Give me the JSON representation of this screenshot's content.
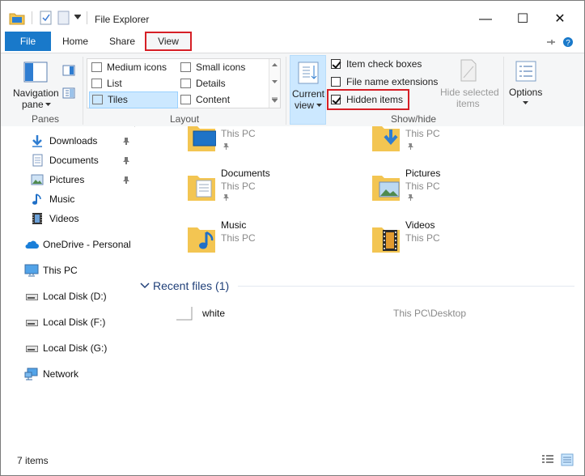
{
  "window": {
    "title": "File Explorer",
    "minimize_glyph": "—",
    "maximize_glyph": "☐",
    "close_glyph": "✕"
  },
  "tabs": [
    {
      "label": "File"
    },
    {
      "label": "Home"
    },
    {
      "label": "Share"
    },
    {
      "label": "View"
    }
  ],
  "tabs_right": {
    "collapse_glyph": "⌄",
    "help_glyph": "?"
  },
  "ribbon": {
    "panes": {
      "navigation_pane_line1": "Navigation",
      "navigation_pane_line2": "pane",
      "group_label": "Panes"
    },
    "layout": {
      "items": [
        {
          "label": "Medium icons"
        },
        {
          "label": "Small icons"
        },
        {
          "label": "List"
        },
        {
          "label": "Details"
        },
        {
          "label": "Tiles"
        },
        {
          "label": "Content"
        }
      ],
      "selected": "Tiles",
      "group_label": "Layout"
    },
    "current_view": {
      "line1": "Current",
      "line2": "view"
    },
    "show_hide": {
      "item_check_boxes": {
        "label": "Item check boxes",
        "checked": true
      },
      "file_name_extensions": {
        "label": "File name extensions",
        "checked": false
      },
      "hidden_items": {
        "label": "Hidden items",
        "checked": true
      },
      "hide_selected_line1": "Hide selected",
      "hide_selected_line2": "items",
      "group_label": "Show/hide"
    },
    "options": {
      "label": "Options"
    }
  },
  "nav_pane": {
    "quick_access": [
      {
        "label": "Downloads",
        "icon": "download-arrow-icon"
      },
      {
        "label": "Documents",
        "icon": "documents-icon"
      },
      {
        "label": "Pictures",
        "icon": "pictures-icon"
      },
      {
        "label": "Music",
        "icon": "music-note-icon"
      },
      {
        "label": "Videos",
        "icon": "film-icon"
      }
    ],
    "onedrive": "OneDrive - Personal",
    "this_pc": "This PC",
    "drives": [
      {
        "label": "Local Disk (D:)"
      },
      {
        "label": "Local Disk (F:)"
      },
      {
        "label": "Local Disk (G:)"
      }
    ],
    "network": "Network"
  },
  "content": {
    "folders": [
      {
        "name": "",
        "location": "This PC",
        "icon": "desktop-folder-icon"
      },
      {
        "name": "",
        "location": "This PC",
        "icon": "downloads-folder-icon"
      },
      {
        "name": "Documents",
        "location": "This PC",
        "icon": "documents-folder-icon"
      },
      {
        "name": "Pictures",
        "location": "This PC",
        "icon": "pictures-folder-icon"
      },
      {
        "name": "Music",
        "location": "This PC",
        "icon": "music-folder-icon"
      },
      {
        "name": "Videos",
        "location": "This PC",
        "icon": "videos-folder-icon"
      }
    ],
    "recent_header": "Recent files (1)",
    "recent_files": [
      {
        "name": "white",
        "path": "This PC\\Desktop"
      }
    ]
  },
  "status": {
    "items_count": "7 items"
  },
  "colors": {
    "accent": "#1979ca",
    "highlight_red": "#d61f26",
    "selection": "#cce8ff",
    "folder": "#f3c552"
  }
}
